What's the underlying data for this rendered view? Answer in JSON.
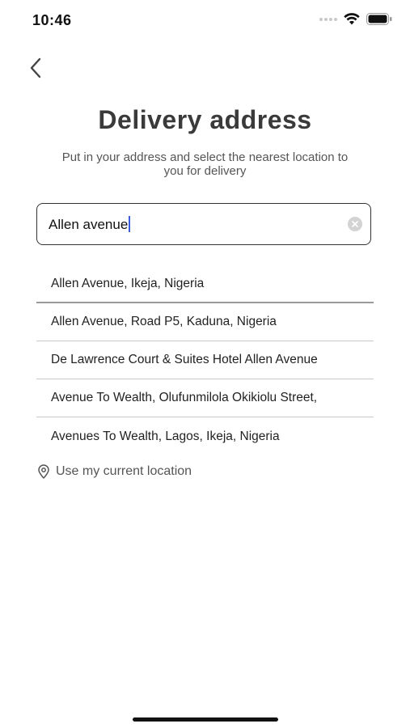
{
  "status_bar": {
    "time": "10:46"
  },
  "header": {
    "title": "Delivery address",
    "subtitle": "Put in your address and select the nearest location to you for delivery"
  },
  "search": {
    "value": "Allen avenue"
  },
  "suggestions": [
    {
      "label": "Allen Avenue, Ikeja, Nigeria"
    },
    {
      "label": "Allen Avenue, Road P5, Kaduna, Nigeria"
    },
    {
      "label": "De Lawrence Court & Suites Hotel Allen Avenue"
    },
    {
      "label": "Avenue To Wealth, Olufunmilola Okikiolu Street,"
    },
    {
      "label": "Avenues To Wealth, Lagos, Ikeja, Nigeria"
    }
  ],
  "current_location": {
    "label": "Use my current location"
  },
  "icons": {
    "back": "chevron-left-icon",
    "clear": "clear-icon",
    "location": "location-pin-icon",
    "wifi": "wifi-icon",
    "battery": "battery-icon"
  }
}
